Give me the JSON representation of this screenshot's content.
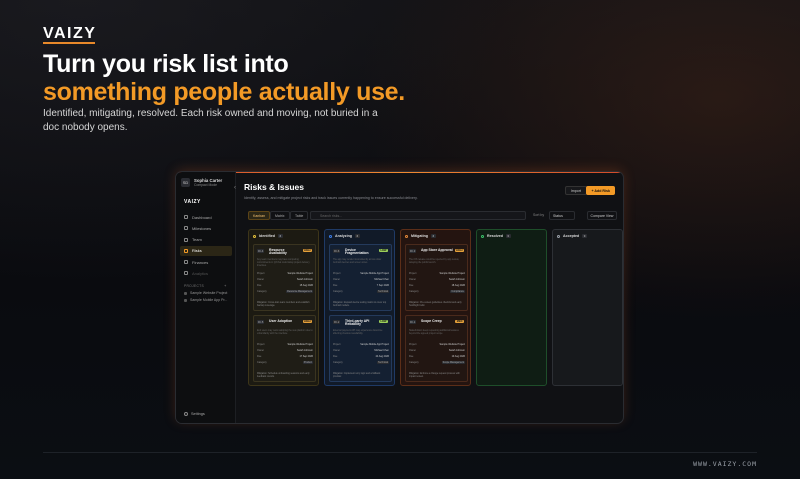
{
  "brand": {
    "logo": "VAIZY",
    "url": "WWW.VAIZY.COM",
    "accent": "#f39a26"
  },
  "hero": {
    "headline_line1": "Turn you risk list into",
    "headline_line2": "something people actually use.",
    "subtitle": "Identified, mitigating, resolved. Each risk owned and moving, not buried in a doc nobody opens."
  },
  "app": {
    "workspace": {
      "avatar": "SD",
      "name": "Sophia Carter",
      "plan": "Compact Mode"
    },
    "side_logo": "VAIZY",
    "nav": [
      {
        "label": "Dashboard",
        "icon": "dashboard-icon"
      },
      {
        "label": "Milestones",
        "icon": "flag-icon"
      },
      {
        "label": "Team",
        "icon": "team-icon"
      },
      {
        "label": "Risks",
        "icon": "warning-icon",
        "active": true
      },
      {
        "label": "Finances",
        "icon": "finance-icon"
      },
      {
        "label": "Analytics",
        "icon": "chart-icon",
        "dim": true
      }
    ],
    "projects_label": "PROJECTS",
    "projects": [
      "Sample Website Project",
      "Sample Mobile App Pr..."
    ],
    "settings": "Settings",
    "page_title": "Risks & Issues",
    "page_desc": "Identify, assess, and mitigate project risks and track issues currently happening to ensure successful delivery.",
    "back": "‹",
    "import": "Import",
    "add": "+ Add Risk",
    "views": [
      "Kanban",
      "Matrix",
      "Table"
    ],
    "search_placeholder": "Search risks...",
    "sort_label": "Sort by",
    "sort_value": "Status",
    "compare": "Compare View",
    "columns": [
      {
        "key": "ident",
        "label": "Identified",
        "count": "2",
        "color": "#e6c13a",
        "cards": [
          {
            "id": "RI-4",
            "name": "Resource Availability",
            "badge": "HIGH",
            "level": "high",
            "desc": "Key team members may have competing commitments in Q3 that could delay project delivery timelines.",
            "project": "Sample Website Project",
            "owner": "Sarah Johnson",
            "date": "15 Aug 2026",
            "category": "Resource Management",
            "mitigation": "Mitigation: Cross-train team members and establish backup coverage."
          },
          {
            "id": "RI-5",
            "name": "User Adoption",
            "badge": "HIGH",
            "level": "high",
            "desc": "End users may resist adopting the new platform due to unfamiliarity with the interface.",
            "project": "Sample Website Project",
            "owner": "Sarah Johnson",
            "date": "17 Sep 2026",
            "category": "Product",
            "mitigation": "Mitigation: Schedule onboarding sessions and early feedback rounds."
          }
        ]
      },
      {
        "key": "anal",
        "label": "Analyzing",
        "count": "2",
        "color": "#3a7be6",
        "cards": [
          {
            "id": "RI-6",
            "name": "Device Fragmentation",
            "badge": "LOW",
            "level": "low",
            "desc": "The app may render inconsistently across older Android devices and screen sizes.",
            "project": "Sample Mobile App Project",
            "owner": "Michael Chen",
            "date": "7 Sep 2026",
            "category": "Technical",
            "mitigation": "Mitigation: Expand device testing matrix to cover top Android models."
          },
          {
            "id": "RI-2",
            "name": "Third-party API Reliability",
            "badge": "LOW",
            "level": "low",
            "desc": "External payment API may experience downtime affecting checkout availability.",
            "project": "Sample Mobile App Project",
            "owner": "Michael Chen",
            "date": "24 Aug 2026",
            "category": "Technical",
            "mitigation": "Mitigation: Implement retry logic and a fallback provider."
          }
        ]
      },
      {
        "key": "miti",
        "label": "Mitigating",
        "count": "2",
        "color": "#e6893a",
        "cards": [
          {
            "id": "RI-3",
            "name": "App Store Approval",
            "badge": "HIGH",
            "level": "high",
            "desc": "The iOS release could be rejected by app review, delaying the public launch.",
            "project": "Sample Website Project",
            "owner": "Sarah Johnson",
            "date": "18 Aug 2026",
            "category": "Compliance",
            "mitigation": "Mitigation: Pre-review guidelines checklist and early TestFlight build."
          },
          {
            "id": "RI-1",
            "name": "Scope Creep",
            "badge": "MED",
            "level": "high",
            "desc": "Stakeholders keep requesting additional features beyond the agreed project scope.",
            "project": "Sample Website Project",
            "owner": "Sarah Johnson",
            "date": "10 Aug 2026",
            "category": "Scope Management",
            "mitigation": "Mitigation: Enforce a change request process with impact review."
          }
        ]
      },
      {
        "key": "reso",
        "label": "Resolved",
        "count": "0",
        "color": "#3ac26a",
        "cards": []
      },
      {
        "key": "acc",
        "label": "Accepted",
        "count": "0",
        "color": "#9aa0a8",
        "cards": []
      }
    ],
    "card_labels": {
      "project": "Project",
      "owner": "Owner",
      "due": "Due",
      "category": "Category"
    }
  }
}
